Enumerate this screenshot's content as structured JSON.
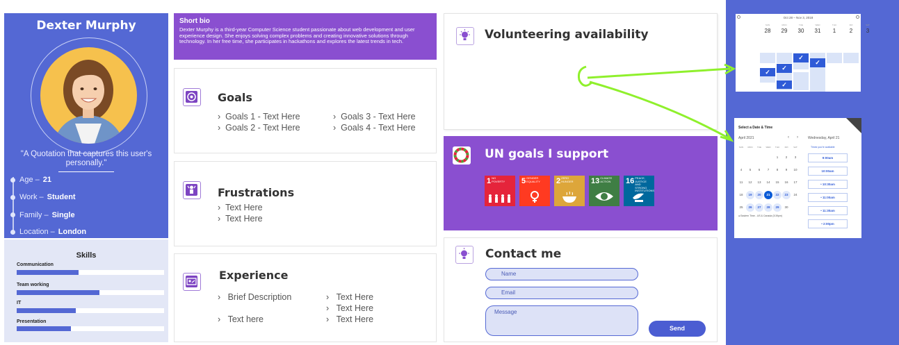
{
  "profile": {
    "name": "Dexter Murphy",
    "quote": "\"A Quotation that captures this user's personally.\"",
    "facts": [
      {
        "label": "Age –",
        "value": "21"
      },
      {
        "label": "Work –",
        "value": "Student"
      },
      {
        "label": "Family –",
        "value": "Single"
      },
      {
        "label": "Location –",
        "value": "London"
      }
    ]
  },
  "skills": {
    "title": "Skills",
    "items": [
      {
        "label": "Communication",
        "level": 0.42
      },
      {
        "label": "Team working",
        "level": 0.56
      },
      {
        "label": "IT",
        "level": 0.4
      },
      {
        "label": "Presentation",
        "level": 0.37
      }
    ]
  },
  "bio": {
    "title": "Short bio",
    "text": "Dexter Murphy is a third-year Computer Science student passionate about web development and user experience design. She enjoys solving complex problems and creating innovative solutions through technology. In her free time, she participates in hackathons and explores the latest trends in tech."
  },
  "goals": {
    "title": "Goals",
    "items": [
      "Goals 1 - Text Here",
      "Goals 2 - Text Here",
      "Goals 3 - Text Here",
      "Goals 4 - Text Here"
    ]
  },
  "frustrations": {
    "title": "Frustrations",
    "items": [
      "Text Here",
      "Text Here"
    ]
  },
  "experience": {
    "title": "Experience",
    "items": [
      "Brief Description",
      "Text here",
      "Text Here",
      "Text Here",
      "Text Here"
    ]
  },
  "volunteering": {
    "title": "Volunteering availability"
  },
  "un_goals": {
    "title": "UN goals I support",
    "tiles": [
      {
        "number": "1",
        "label": "NO POVERTY",
        "color": "#e5243b"
      },
      {
        "number": "5",
        "label": "GENDER EQUALITY",
        "color": "#ff3a21"
      },
      {
        "number": "2",
        "label": "ZERO HUNGER",
        "color": "#dda63a"
      },
      {
        "number": "13",
        "label": "CLIMATE ACTION",
        "color": "#3f7e44"
      },
      {
        "number": "16",
        "label": "PEACE, JUSTICE AND STRONG INSTITUTIONS",
        "color": "#00689d"
      }
    ]
  },
  "contact": {
    "title": "Contact me",
    "name_placeholder": "Name",
    "email_placeholder": "Email",
    "message_placeholder": "Message",
    "send_label": "Send"
  },
  "calendar_week": {
    "range": "Oct 28 – Nov 3, 2018",
    "days": [
      {
        "num": "28",
        "name": "SUN"
      },
      {
        "num": "29",
        "name": "MON"
      },
      {
        "num": "30",
        "name": "TUE"
      },
      {
        "num": "31",
        "name": "WED"
      },
      {
        "num": "1",
        "name": "THU"
      },
      {
        "num": "2",
        "name": "FRI"
      },
      {
        "num": "3",
        "name": "SAT"
      }
    ]
  },
  "calendar_month": {
    "heading": "Select a Date & Time",
    "month": "April 2021",
    "selected_day": "Wednesday, April 21",
    "availability_note": "Times you're available",
    "weekdays": [
      "SUN",
      "MON",
      "TUE",
      "WED",
      "THU",
      "FRI",
      "SAT"
    ],
    "weeks": [
      [
        "",
        "",
        "",
        "",
        "1",
        "2",
        "3"
      ],
      [
        "4",
        "5",
        "6",
        "7",
        "8",
        "9",
        "10"
      ],
      [
        "11",
        "12",
        "13",
        "14",
        "15",
        "16",
        "17"
      ],
      [
        "18",
        "19",
        "20",
        "21",
        "22",
        "23",
        "24"
      ],
      [
        "25",
        "26",
        "27",
        "28",
        "29",
        "30",
        ""
      ]
    ],
    "timezone": "Eastern Time - US & Canada (3:39pm)",
    "slots": [
      "9:00am",
      "10:00am",
      "10:30am",
      "11:00am",
      "11:30am",
      "2:00pm"
    ]
  },
  "colors": {
    "accent_blue": "#5468d4",
    "accent_purple": "#8a4fd0",
    "arrow_green": "#8ff02c"
  }
}
